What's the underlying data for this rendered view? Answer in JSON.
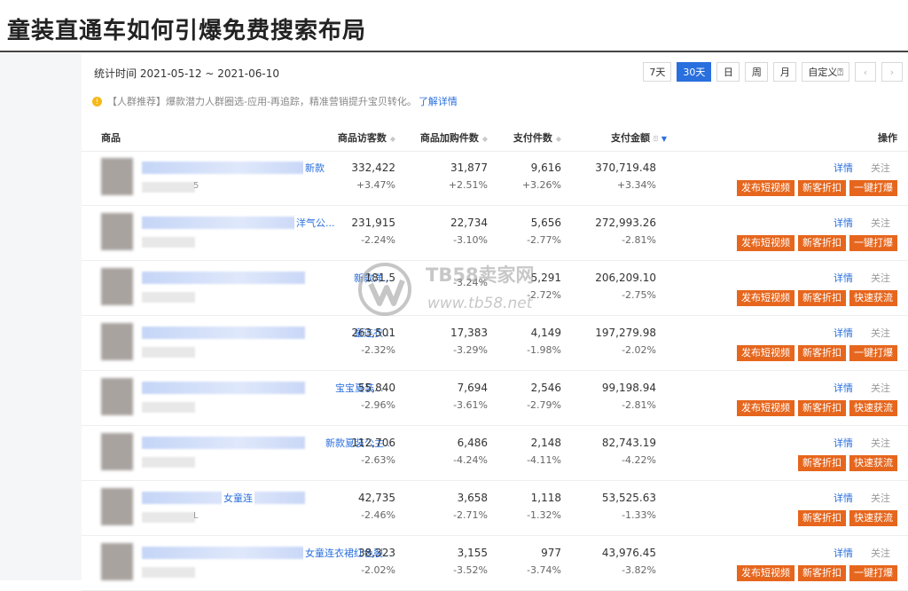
{
  "page_title": "童装直通车如何引爆免费搜索布局",
  "period": "统计时间 2021-05-12 ~ 2021-06-10",
  "ranges": [
    "7天",
    "30天",
    "日",
    "周",
    "月",
    "自定义"
  ],
  "active_range": "30天",
  "custom_help_icon": "question-circle-icon",
  "prev_icon": "chevron-left-icon",
  "next_icon": "chevron-right-icon",
  "notice": {
    "text": "【人群推荐】爆款潜力人群圈选-应用-再追踪，精准营销提升宝贝转化。",
    "link": "了解详情"
  },
  "columns": {
    "product": "商品",
    "visitors": "商品访客数",
    "cart": "商品加购件数",
    "paid_items": "支付件数",
    "paid_amount": "支付金额",
    "ops": "操作"
  },
  "colors": {
    "accent": "#2a6fde",
    "action": "#e6661d",
    "warn": "#f5b91b"
  },
  "rows": [
    {
      "name": "新款",
      "id_tail": "5",
      "visitors": "332,422",
      "visitors_pct": "+3.47%",
      "cart": "31,877",
      "cart_pct": "+2.51%",
      "paid": "9,616",
      "paid_pct": "+3.26%",
      "amount": "370,719.48",
      "amount_pct": "+3.34%",
      "detail": "详情",
      "follow": "关注",
      "btns": [
        "发布短视频",
        "新客折扣",
        "一键打爆"
      ]
    },
    {
      "name": "洋气公...",
      "id_tail": "",
      "visitors": "231,915",
      "visitors_pct": "-2.24%",
      "cart": "22,734",
      "cart_pct": "-3.10%",
      "paid": "5,656",
      "paid_pct": "-2.77%",
      "amount": "272,993.26",
      "amount_pct": "-2.81%",
      "detail": "详情",
      "follow": "关注",
      "btns": [
        "发布短视频",
        "新客折扣",
        "一键打爆"
      ]
    },
    {
      "name": "新款洋...",
      "id_tail": "",
      "visitors": "181,5",
      "visitors_pct": "",
      "cart": "",
      "cart_pct": "-3.24%",
      "paid": "5,291",
      "paid_pct": "-2.72%",
      "amount": "206,209.10",
      "amount_pct": "-2.75%",
      "detail": "详情",
      "follow": "关注",
      "btns": [
        "发布短视频",
        "新客折扣",
        "快速获流"
      ]
    },
    {
      "name": "童连衣...",
      "id_tail": "",
      "visitors": "263,501",
      "visitors_pct": "-2.32%",
      "cart": "17,383",
      "cart_pct": "-3.29%",
      "paid": "4,149",
      "paid_pct": "-1.98%",
      "amount": "197,279.98",
      "amount_pct": "-2.02%",
      "detail": "详情",
      "follow": "关注",
      "btns": [
        "发布短视频",
        "新客折扣",
        "一键打爆"
      ]
    },
    {
      "name": "宝宝夏装...",
      "id_tail": "",
      "visitors": "55,840",
      "visitors_pct": "-2.96%",
      "cart": "7,694",
      "cart_pct": "-3.61%",
      "paid": "2,546",
      "paid_pct": "-2.79%",
      "amount": "99,198.94",
      "amount_pct": "-2.81%",
      "detail": "详情",
      "follow": "关注",
      "btns": [
        "发布短视频",
        "新客折扣",
        "快速获流"
      ]
    },
    {
      "name": "新款夏装公主...",
      "id_tail": "",
      "visitors": "112,706",
      "visitors_pct": "-2.63%",
      "cart": "6,486",
      "cart_pct": "-4.24%",
      "paid": "2,148",
      "paid_pct": "-4.11%",
      "amount": "82,743.19",
      "amount_pct": "-4.22%",
      "detail": "详情",
      "follow": "关注",
      "btns": [
        "新客折扣",
        "快速获流"
      ]
    },
    {
      "name": "女童连",
      "id_tail": "L",
      "visitors": "42,735",
      "visitors_pct": "-2.46%",
      "cart": "3,658",
      "cart_pct": "-2.71%",
      "paid": "1,118",
      "paid_pct": "-1.32%",
      "amount": "53,525.63",
      "amount_pct": "-1.33%",
      "detail": "详情",
      "follow": "关注",
      "btns": [
        "新客折扣",
        "快速获流"
      ]
    },
    {
      "name": "女童连衣裙红色裂...",
      "id_tail": "",
      "visitors": "38,323",
      "visitors_pct": "-2.02%",
      "cart": "3,155",
      "cart_pct": "-3.52%",
      "paid": "977",
      "paid_pct": "-3.74%",
      "amount": "43,976.45",
      "amount_pct": "-3.82%",
      "detail": "详情",
      "follow": "关注",
      "btns": [
        "发布短视频",
        "新客折扣",
        "一键打爆"
      ]
    }
  ],
  "watermark": {
    "brand": "TB58卖家网",
    "url": "www.tb58.net"
  }
}
